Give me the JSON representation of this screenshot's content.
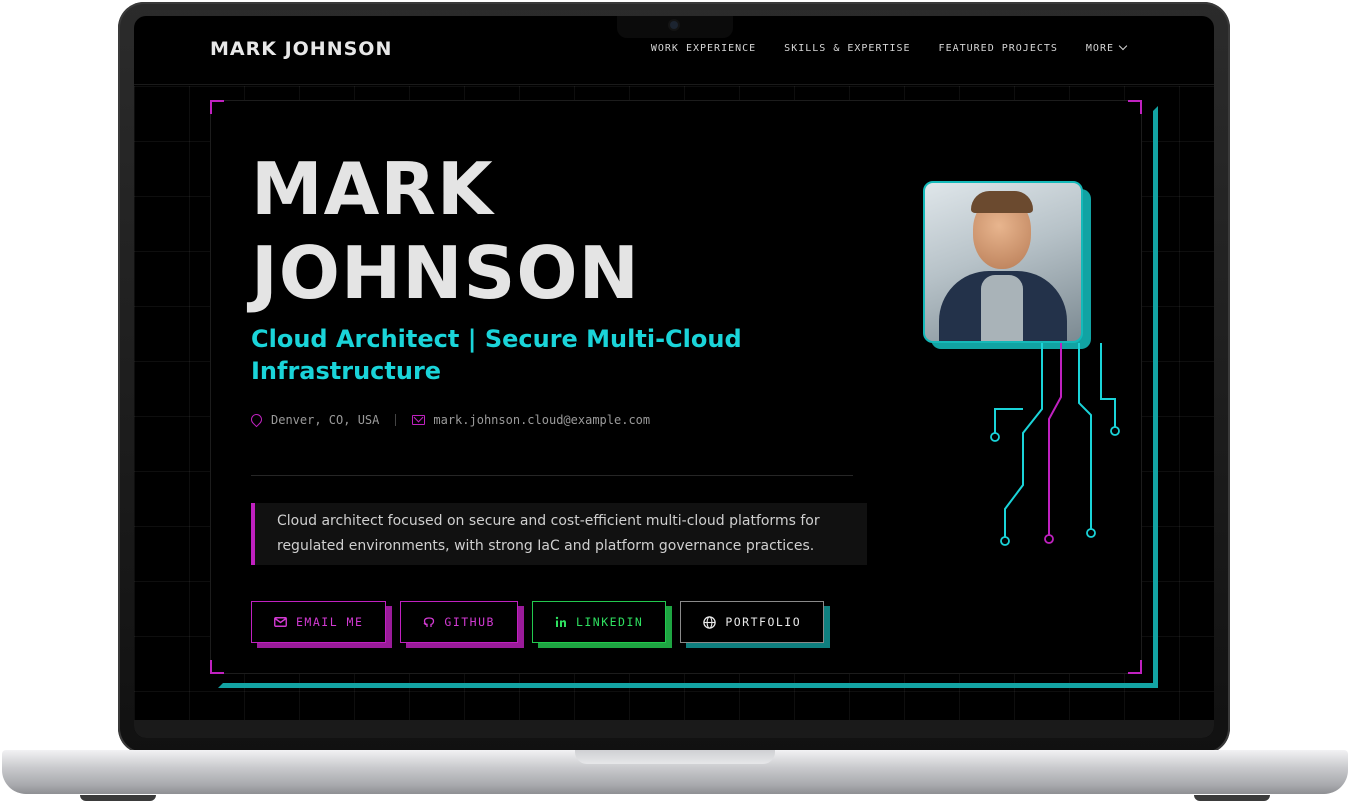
{
  "header": {
    "brand": "MARK JOHNSON",
    "nav": [
      "WORK EXPERIENCE",
      "SKILLS & EXPERTISE",
      "FEATURED PROJECTS",
      "MORE"
    ]
  },
  "hero": {
    "name_line1": "MARK",
    "name_line2": "JOHNSON",
    "subtitle": "Cloud Architect | Secure Multi-Cloud Infrastructure",
    "location": "Denver, CO, USA",
    "email": "mark.johnson.cloud@example.com",
    "summary": "Cloud architect focused on secure and cost-efficient multi-cloud platforms for regulated environments, with strong IaC and platform governance practices."
  },
  "buttons": {
    "email": "EMAIL ME",
    "github": "GITHUB",
    "linkedin": "LINKEDIN",
    "portfolio": "PORTFOLIO"
  },
  "icons": {
    "location": "map-pin-icon",
    "email": "mail-icon",
    "github": "github-icon",
    "linkedin": "linkedin-icon",
    "portfolio": "globe-icon",
    "more": "chevron-down-icon"
  },
  "colors": {
    "background": "#000000",
    "accent_cyan": "#1ad4d9",
    "accent_magenta": "#c021c0",
    "accent_green": "#22c94e",
    "text": "#e4e4e4"
  }
}
